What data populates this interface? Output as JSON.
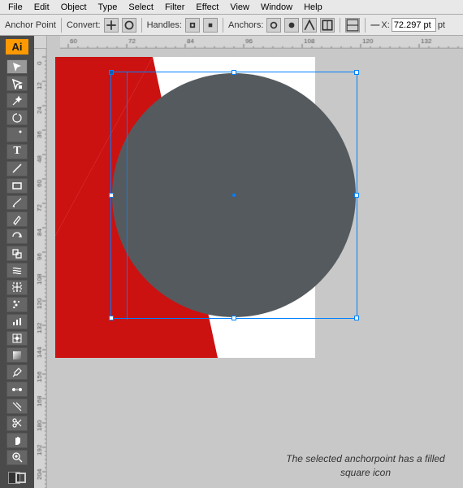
{
  "menubar": {
    "items": [
      "File",
      "Edit",
      "Object",
      "Type",
      "Select",
      "Filter",
      "Effect",
      "View",
      "Window",
      "Help"
    ]
  },
  "toolbar": {
    "anchor_point_label": "Anchor Point",
    "convert_label": "Convert:",
    "handles_label": "Handles:",
    "anchors_label": "Anchors:",
    "x_label": "X:",
    "x_value": "72.297 pt"
  },
  "canvas": {
    "annotation_text": "The selected anchorpoint has a filled square icon"
  },
  "tools": [
    {
      "name": "select-tool",
      "icon": "▶"
    },
    {
      "name": "direct-select-tool",
      "icon": "↗"
    },
    {
      "name": "magic-wand-tool",
      "icon": "✦"
    },
    {
      "name": "lasso-tool",
      "icon": "⌇"
    },
    {
      "name": "pen-tool",
      "icon": "✒"
    },
    {
      "name": "type-tool",
      "icon": "T"
    },
    {
      "name": "line-tool",
      "icon": "/"
    },
    {
      "name": "rect-tool",
      "icon": "□"
    },
    {
      "name": "paintbrush-tool",
      "icon": "🖌"
    },
    {
      "name": "pencil-tool",
      "icon": "✏"
    },
    {
      "name": "rotate-tool",
      "icon": "↺"
    },
    {
      "name": "scale-tool",
      "icon": "⤡"
    },
    {
      "name": "warp-tool",
      "icon": "≋"
    },
    {
      "name": "free-transform-tool",
      "icon": "⊞"
    },
    {
      "name": "symbol-sprayer-tool",
      "icon": "⊛"
    },
    {
      "name": "graph-tool",
      "icon": "📊"
    },
    {
      "name": "mesh-tool",
      "icon": "⌗"
    },
    {
      "name": "gradient-tool",
      "icon": "◐"
    },
    {
      "name": "eyedropper-tool",
      "icon": "💧"
    },
    {
      "name": "blend-tool",
      "icon": "∞"
    },
    {
      "name": "slice-tool",
      "icon": "✂"
    },
    {
      "name": "scissors-tool",
      "icon": "✁"
    },
    {
      "name": "hand-tool",
      "icon": "✋"
    },
    {
      "name": "zoom-tool",
      "icon": "🔍"
    },
    {
      "name": "fill-color",
      "icon": "■"
    },
    {
      "name": "stroke-color",
      "icon": "□"
    }
  ],
  "ruler": {
    "top_marks": [
      "60",
      "72",
      "84",
      "96",
      "108",
      "120",
      "132"
    ],
    "left_marks": [
      "5",
      "0",
      "4",
      "2",
      "0",
      "4",
      "8",
      "5",
      "6",
      "8",
      "4",
      "4",
      "3",
      "4",
      "2",
      "3",
      "4",
      "4"
    ]
  }
}
